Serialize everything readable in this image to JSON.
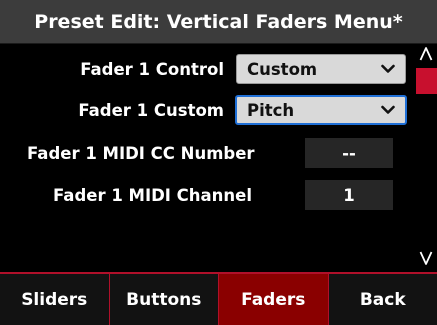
{
  "header": {
    "title": "Preset Edit: Vertical Faders Menu*"
  },
  "fields": [
    {
      "label": "Fader 1 Control",
      "value": "Custom",
      "type": "select"
    },
    {
      "label": "Fader 1 Custom",
      "value": "Pitch",
      "type": "select",
      "focused": true
    },
    {
      "label": "Fader 1 MIDI CC Number",
      "value": "--",
      "type": "value"
    },
    {
      "label": "Fader 1 MIDI Channel",
      "value": "1",
      "type": "value"
    }
  ],
  "scrollbar": {
    "up_icon": "chevron-up-icon",
    "down_icon": "chevron-down-icon",
    "thumb_color": "#c8102e"
  },
  "tabs": [
    {
      "label": "Sliders",
      "active": false
    },
    {
      "label": "Buttons",
      "active": false
    },
    {
      "label": "Faders",
      "active": true
    },
    {
      "label": "Back",
      "active": false
    }
  ],
  "colors": {
    "accent": "#8a0000",
    "focus": "#1f6fd6",
    "header_bg": "#3c3c3c"
  }
}
